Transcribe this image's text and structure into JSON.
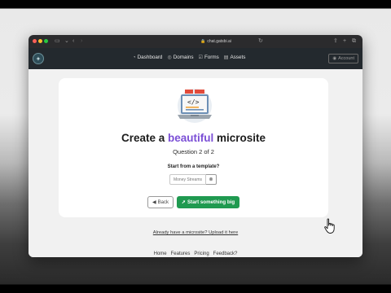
{
  "browser": {
    "url": "chat.gatsbi.ai",
    "lock_icon": "lock-icon",
    "reload_icon": "reload-icon"
  },
  "navbar": {
    "logo_icon": "compass-logo-icon",
    "links": [
      {
        "label": "Dashboard",
        "icon": "dashboard-icon"
      },
      {
        "label": "Domains",
        "icon": "globe-icon"
      },
      {
        "label": "Forms",
        "icon": "checkbox-icon"
      },
      {
        "label": "Assets",
        "icon": "images-icon"
      }
    ],
    "account_label": "Account"
  },
  "card": {
    "headline_before": "Create a ",
    "headline_accent": "beautiful",
    "headline_after": " microsite",
    "question": "Question 2 of 2",
    "template_label": "Start from a template?",
    "template_value": "Money Streams",
    "back_label": "Back",
    "go_label": "Start something big"
  },
  "upload_link": "Already have a microsite? Upload it here",
  "footer": {
    "links": [
      "Home",
      "Features",
      "Pricing",
      "Feedback?"
    ]
  },
  "colors": {
    "accent_purple": "#7b4fd6",
    "primary_green": "#1f9a50",
    "navbar_bg": "#23292e"
  }
}
